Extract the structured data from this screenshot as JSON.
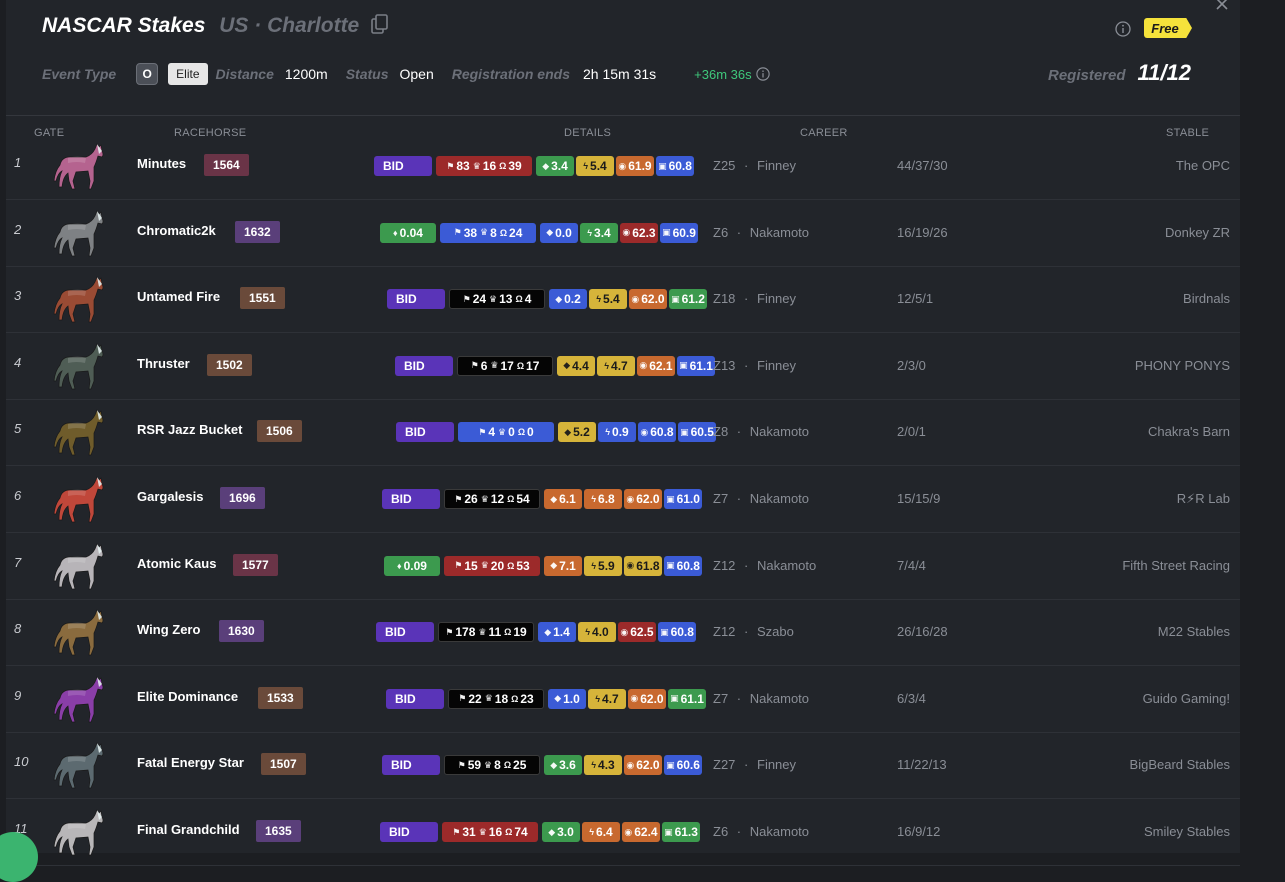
{
  "header": {
    "title": "NASCAR Stakes",
    "location": "US · Charlotte",
    "free_badge": "Free",
    "meta": {
      "event_type_label": "Event Type",
      "class_chip": "O",
      "class_label": "Elite",
      "distance_label": "Distance",
      "distance_value": "1200m",
      "status_label": "Status",
      "status_value": "Open",
      "registration_label": "Registration ends",
      "registration_value": "2h 15m 31s",
      "extra_time": "+36m 36s"
    },
    "registered_label": "Registered",
    "registered_value": "11/12"
  },
  "columns": {
    "gate": "GATE",
    "racehorse": "RACEHORSE",
    "details": "DETAILS",
    "career": "CAREER",
    "stable": "STABLE"
  },
  "colors": {
    "bid": "#5a34b8",
    "green": "#3c9a4e",
    "yellow": "#d6b43a",
    "orange": "#c8692f",
    "red": "#9c2a2a",
    "blue": "#3b5bd6",
    "accent_free": "#f5e23b"
  },
  "icons": [
    "copy-icon",
    "info-icon",
    "close-icon",
    "eth-icon",
    "flag-icon",
    "trophy-icon",
    "medal-icon",
    "horseshoe-icon",
    "bolt-icon",
    "gauge-icon",
    "fuel-icon"
  ],
  "rows": [
    {
      "gate": "1",
      "name": "Minutes",
      "rating": "1564",
      "rating_color": "#6a3447",
      "bid": "BID",
      "price": "",
      "stats_color": "red",
      "stats": {
        "a": "83",
        "b": "16",
        "c": "39"
      },
      "attrs": [
        {
          "v": "3.4",
          "c": "#3c9a4e"
        },
        {
          "v": "5.4",
          "c": "#d6b43a"
        },
        {
          "v": "61.9",
          "c": "#c8692f"
        },
        {
          "v": "60.8",
          "c": "#3b5bd6"
        }
      ],
      "zone": "Z25",
      "jockey": "Finney",
      "record": "44/37/30",
      "stable": "The OPC",
      "coat": "#b5638f"
    },
    {
      "gate": "2",
      "name": "Chromatic2k",
      "rating": "1632",
      "rating_color": "#5a3f7a",
      "bid": "",
      "price": "0.04",
      "stats_color": "blue",
      "stats": {
        "a": "38",
        "b": "8",
        "c": "24"
      },
      "attrs": [
        {
          "v": "0.0",
          "c": "#3b5bd6"
        },
        {
          "v": "3.4",
          "c": "#3c9a4e"
        },
        {
          "v": "62.3",
          "c": "#9c2a2a"
        },
        {
          "v": "60.9",
          "c": "#3b5bd6"
        }
      ],
      "zone": "Z6",
      "jockey": "Nakamoto",
      "record": "16/19/26",
      "stable": "Donkey ZR",
      "coat": "#7e8184"
    },
    {
      "gate": "3",
      "name": "Untamed Fire",
      "rating": "1551",
      "rating_color": "#6a4a3a",
      "bid": "BID",
      "price": "",
      "stats_color": "black",
      "stats": {
        "a": "24",
        "b": "13",
        "c": "4"
      },
      "attrs": [
        {
          "v": "0.2",
          "c": "#3b5bd6"
        },
        {
          "v": "5.4",
          "c": "#d6b43a"
        },
        {
          "v": "62.0",
          "c": "#c8692f"
        },
        {
          "v": "61.2",
          "c": "#3c9a4e"
        }
      ],
      "zone": "Z18",
      "jockey": "Finney",
      "record": "12/5/1",
      "stable": "Birdnals",
      "coat": "#9a4b34"
    },
    {
      "gate": "4",
      "name": "Thruster",
      "rating": "1502",
      "rating_color": "#6a4a3a",
      "bid": "BID",
      "price": "",
      "stats_color": "black",
      "stats": {
        "a": "6",
        "b": "17",
        "c": "17"
      },
      "attrs": [
        {
          "v": "4.4",
          "c": "#d6b43a"
        },
        {
          "v": "4.7",
          "c": "#d6b43a"
        },
        {
          "v": "62.1",
          "c": "#c8692f"
        },
        {
          "v": "61.1",
          "c": "#3b5bd6"
        }
      ],
      "zone": "Z13",
      "jockey": "Finney",
      "record": "2/3/0",
      "stable": "PHONY PONYS",
      "coat": "#4f5d55"
    },
    {
      "gate": "5",
      "name": "RSR Jazz Bucket",
      "rating": "1506",
      "rating_color": "#6a4a3a",
      "bid": "BID",
      "price": "",
      "stats_color": "blue",
      "stats": {
        "a": "4",
        "b": "0",
        "c": "0"
      },
      "attrs": [
        {
          "v": "5.2",
          "c": "#d6b43a"
        },
        {
          "v": "0.9",
          "c": "#3b5bd6"
        },
        {
          "v": "60.8",
          "c": "#3b5bd6"
        },
        {
          "v": "60.5",
          "c": "#3b5bd6"
        }
      ],
      "zone": "Z8",
      "jockey": "Nakamoto",
      "record": "2/0/1",
      "stable": "Chakra's Barn",
      "coat": "#6f5c2b"
    },
    {
      "gate": "6",
      "name": "Gargalesis",
      "rating": "1696",
      "rating_color": "#5a3f7a",
      "bid": "BID",
      "price": "",
      "stats_color": "black",
      "stats": {
        "a": "26",
        "b": "12",
        "c": "54"
      },
      "attrs": [
        {
          "v": "6.1",
          "c": "#c8692f"
        },
        {
          "v": "6.8",
          "c": "#c8692f"
        },
        {
          "v": "62.0",
          "c": "#c8692f"
        },
        {
          "v": "61.0",
          "c": "#3b5bd6"
        }
      ],
      "zone": "Z7",
      "jockey": "Nakamoto",
      "record": "15/15/9",
      "stable": "R⚡R Lab",
      "coat": "#c0473a"
    },
    {
      "gate": "7",
      "name": "Atomic Kaus",
      "rating": "1577",
      "rating_color": "#6a3447",
      "bid": "",
      "price": "0.09",
      "stats_color": "red",
      "stats": {
        "a": "15",
        "b": "20",
        "c": "53"
      },
      "attrs": [
        {
          "v": "7.1",
          "c": "#c8692f"
        },
        {
          "v": "5.9",
          "c": "#d6b43a"
        },
        {
          "v": "61.8",
          "c": "#d6b43a"
        },
        {
          "v": "60.8",
          "c": "#3b5bd6"
        }
      ],
      "zone": "Z12",
      "jockey": "Nakamoto",
      "record": "7/4/4",
      "stable": "Fifth Street Racing",
      "coat": "#b7b4b8"
    },
    {
      "gate": "8",
      "name": "Wing Zero",
      "rating": "1630",
      "rating_color": "#5a3f7a",
      "bid": "BID",
      "price": "",
      "stats_color": "black",
      "stats": {
        "a": "178",
        "b": "11",
        "c": "19"
      },
      "attrs": [
        {
          "v": "1.4",
          "c": "#3b5bd6"
        },
        {
          "v": "4.0",
          "c": "#d6b43a"
        },
        {
          "v": "62.5",
          "c": "#9c2a2a"
        },
        {
          "v": "60.8",
          "c": "#3b5bd6"
        }
      ],
      "zone": "Z12",
      "jockey": "Szabo",
      "record": "26/16/28",
      "stable": "M22 Stables",
      "coat": "#8a6b3e"
    },
    {
      "gate": "9",
      "name": "Elite Dominance",
      "rating": "1533",
      "rating_color": "#6a4a3a",
      "bid": "BID",
      "price": "",
      "stats_color": "black",
      "stats": {
        "a": "22",
        "b": "18",
        "c": "23"
      },
      "attrs": [
        {
          "v": "1.0",
          "c": "#3b5bd6"
        },
        {
          "v": "4.7",
          "c": "#d6b43a"
        },
        {
          "v": "62.0",
          "c": "#c8692f"
        },
        {
          "v": "61.1",
          "c": "#3c9a4e"
        }
      ],
      "zone": "Z7",
      "jockey": "Nakamoto",
      "record": "6/3/4",
      "stable": "Guido Gaming!",
      "coat": "#8a3ea8"
    },
    {
      "gate": "10",
      "name": "Fatal Energy Star",
      "rating": "1507",
      "rating_color": "#6a4a3a",
      "bid": "BID",
      "price": "",
      "stats_color": "black",
      "stats": {
        "a": "59",
        "b": "8",
        "c": "25"
      },
      "attrs": [
        {
          "v": "3.6",
          "c": "#3c9a4e"
        },
        {
          "v": "4.3",
          "c": "#d6b43a"
        },
        {
          "v": "62.0",
          "c": "#c8692f"
        },
        {
          "v": "60.6",
          "c": "#3b5bd6"
        }
      ],
      "zone": "Z27",
      "jockey": "Finney",
      "record": "11/22/13",
      "stable": "BigBeard Stables",
      "coat": "#5c6a70"
    },
    {
      "gate": "11",
      "name": "Final Grandchild",
      "rating": "1635",
      "rating_color": "#5a3f7a",
      "bid": "BID",
      "price": "",
      "stats_color": "red",
      "stats": {
        "a": "31",
        "b": "16",
        "c": "74"
      },
      "attrs": [
        {
          "v": "3.0",
          "c": "#3c9a4e"
        },
        {
          "v": "6.4",
          "c": "#c8692f"
        },
        {
          "v": "62.4",
          "c": "#c8692f"
        },
        {
          "v": "61.3",
          "c": "#3c9a4e"
        }
      ],
      "zone": "Z6",
      "jockey": "Nakamoto",
      "record": "16/9/12",
      "stable": "Smiley Stables",
      "coat": "#b8b6b8"
    }
  ]
}
